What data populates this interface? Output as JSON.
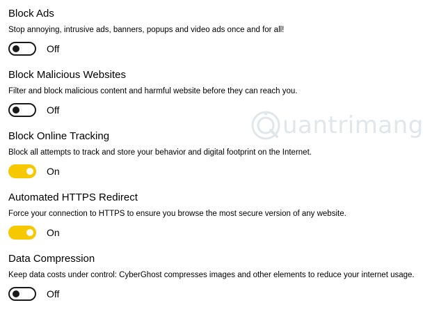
{
  "settings": [
    {
      "title": "Block Ads",
      "description": "Stop annoying, intrusive ads, banners, popups and video ads once and for all!",
      "state_label": "Off",
      "enabled": false
    },
    {
      "title": "Block Malicious Websites",
      "description": "Filter and block malicious content and harmful website before they can reach you.",
      "state_label": "Off",
      "enabled": false
    },
    {
      "title": "Block Online Tracking",
      "description": "Block all attempts to track and store your behavior and digital footprint on the Internet.",
      "state_label": "On",
      "enabled": true
    },
    {
      "title": "Automated HTTPS Redirect",
      "description": "Force your connection to HTTPS to ensure you browse the most secure version of any website.",
      "state_label": "On",
      "enabled": true
    },
    {
      "title": "Data Compression",
      "description": "Keep data costs under control: CyberGhost compresses images and other elements to reduce your internet usage.",
      "state_label": "Off",
      "enabled": false
    }
  ],
  "watermark": {
    "text": "uantrimang",
    "icon": "quantrimang-logo-icon"
  },
  "colors": {
    "toggle_on": "#f5c800",
    "toggle_off_border": "#1a1a1a",
    "text": "#000000",
    "background": "#ffffff"
  }
}
